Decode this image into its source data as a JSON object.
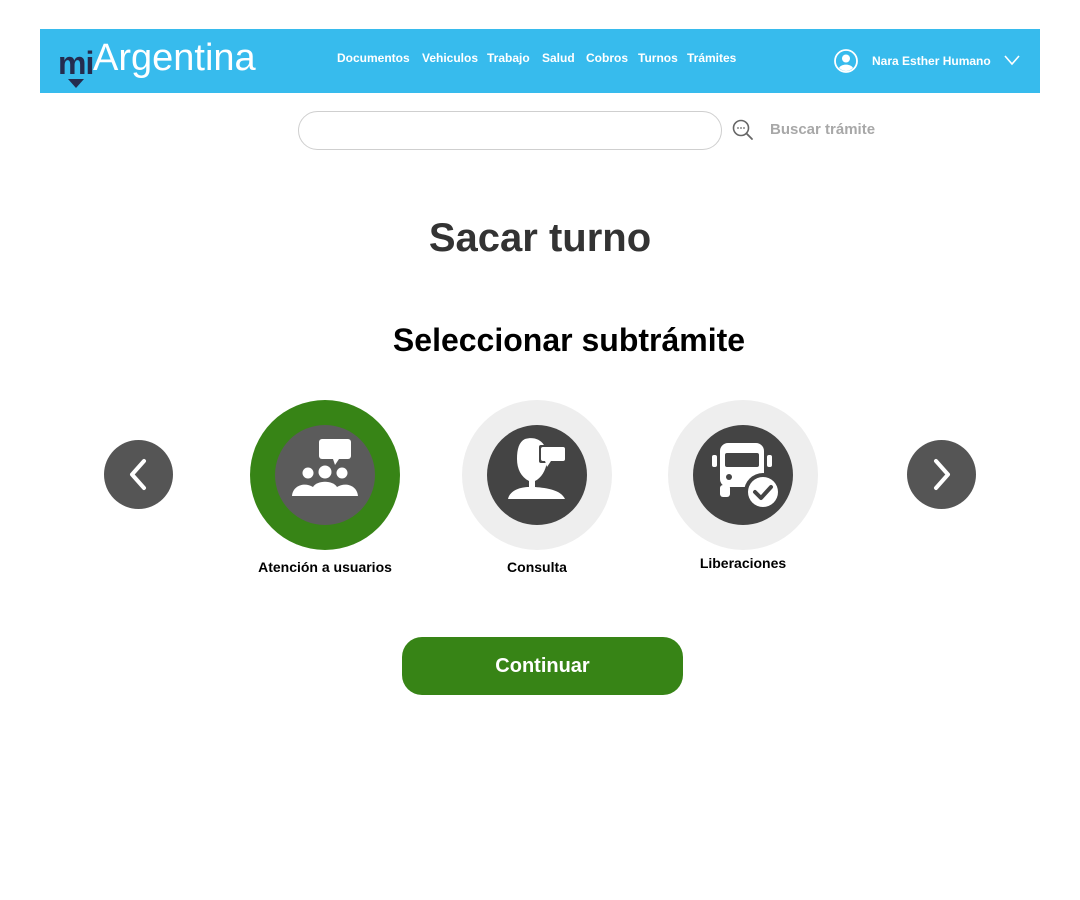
{
  "header": {
    "logo_prefix": "mi",
    "logo_text": "Argentina",
    "nav": [
      {
        "label": "Documentos"
      },
      {
        "label": "Vehiculos"
      },
      {
        "label": "Trabajo"
      },
      {
        "label": "Salud"
      },
      {
        "label": "Cobros"
      },
      {
        "label": "Turnos"
      },
      {
        "label": "Trámites"
      }
    ],
    "user_name": "Nara Esther Humano",
    "user_icon": "user-circle-icon",
    "chevron_icon": "chevron-down-icon"
  },
  "search": {
    "value": "",
    "placeholder": "",
    "icon": "search-icon",
    "label": "Buscar trámite"
  },
  "main": {
    "title": "Sacar turno",
    "subtitle": "Seleccionar subtrámite",
    "options": [
      {
        "label": "Atención a usuarios",
        "icon": "group-chat-icon",
        "selected": true
      },
      {
        "label": "Consulta",
        "icon": "person-chat-icon",
        "selected": false
      },
      {
        "label": "Liberaciones",
        "icon": "truck-check-icon",
        "selected": false
      }
    ],
    "prev_icon": "chevron-left-icon",
    "next_icon": "chevron-right-icon",
    "continue_label": "Continuar"
  },
  "colors": {
    "header_bg": "#37bbed",
    "logo_dark": "#242c4f",
    "selected_ring": "#378416",
    "unselected_ring": "#eeeeee",
    "icon_bg": "#555555",
    "button_bg": "#378416"
  }
}
